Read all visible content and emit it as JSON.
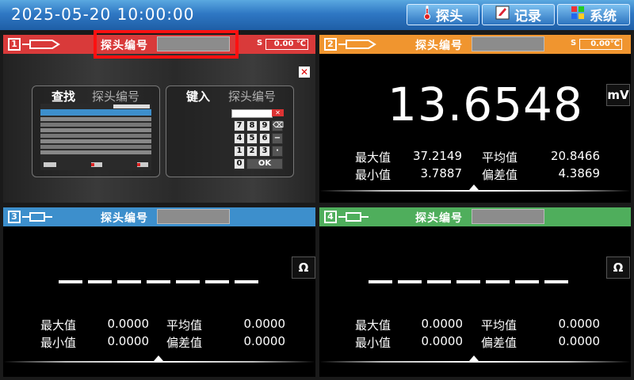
{
  "header": {
    "datetime": "2025-05-20  10:00:00",
    "nav": [
      {
        "label": "探头",
        "icon": "thermometer-icon"
      },
      {
        "label": "记录",
        "icon": "record-icon"
      },
      {
        "label": "系统",
        "icon": "system-grid-icon"
      }
    ]
  },
  "colors": {
    "channel1": "#d93a3a",
    "channel2": "#f0952f",
    "channel3": "#3d8fcc",
    "channel4": "#4fae5c",
    "highlight": "#ff1010"
  },
  "channels": [
    {
      "number": "1",
      "probe_label": "探头编号",
      "temp_prefix": "S",
      "temp_value": "0.00 ℃",
      "search_card": {
        "title": "查找",
        "subtitle": "探头编号"
      },
      "input_card": {
        "title": "键入",
        "subtitle": "探头编号"
      },
      "keypad": [
        "7",
        "8",
        "9",
        "⌫",
        "4",
        "5",
        "6",
        "−",
        "1",
        "2",
        "3",
        "·",
        "0",
        "OK"
      ]
    },
    {
      "number": "2",
      "probe_label": "探头编号",
      "temp_prefix": "S",
      "temp_value": "0.00℃",
      "unit": "mV",
      "value": "13.6548",
      "max_label": "最大值",
      "max_value": "37.2149",
      "avg_label": "平均值",
      "avg_value": "20.8466",
      "min_label": "最小值",
      "min_value": "3.7887",
      "dev_label": "偏差值",
      "dev_value": "4.3869"
    },
    {
      "number": "3",
      "probe_label": "探头编号",
      "unit": "Ω",
      "max_label": "最大值",
      "max_value": "0.0000",
      "avg_label": "平均值",
      "avg_value": "0.0000",
      "min_label": "最小值",
      "min_value": "0.0000",
      "dev_label": "偏差值",
      "dev_value": "0.0000"
    },
    {
      "number": "4",
      "probe_label": "探头编号",
      "unit": "Ω",
      "max_label": "最大值",
      "max_value": "0.0000",
      "avg_label": "平均值",
      "avg_value": "0.0000",
      "min_label": "最小值",
      "min_value": "0.0000",
      "dev_label": "偏差值",
      "dev_value": "0.0000"
    }
  ]
}
